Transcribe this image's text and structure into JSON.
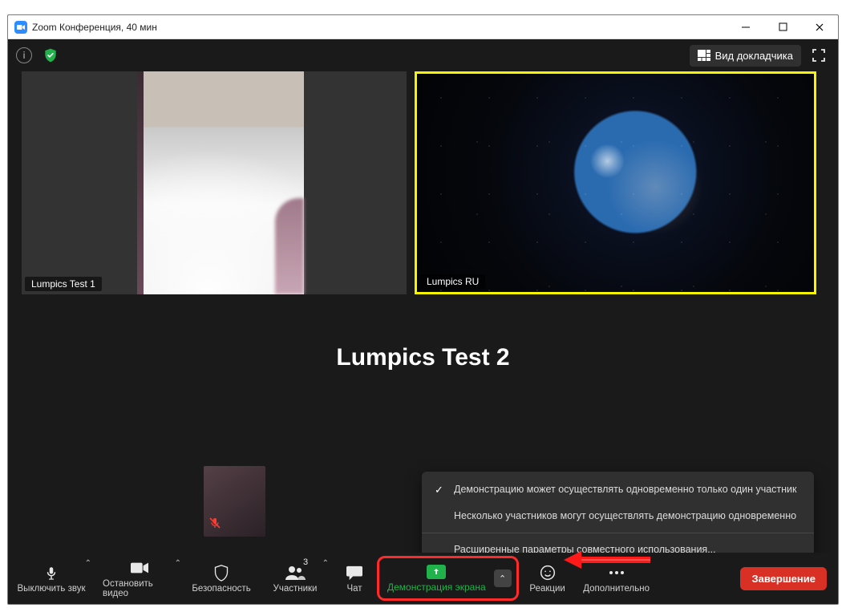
{
  "window": {
    "title": "Zoom Конференция, 40 мин"
  },
  "top": {
    "speaker_view": "Вид докладчика"
  },
  "tiles": {
    "name1": "Lumpics Test 1",
    "name2": "Lumpics RU"
  },
  "main_label": "Lumpics Test 2",
  "share_popup": {
    "opt_single": "Демонстрацию может осуществлять одновременно только один участник",
    "opt_multi": "Несколько участников могут осуществлять демонстрацию одновременно",
    "opt_advanced": "Расширенные параметры совместного использования..."
  },
  "toolbar": {
    "mute": "Выключить звук",
    "video": "Остановить видео",
    "security": "Безопасность",
    "participants": "Участники",
    "participants_count": "3",
    "chat": "Чат",
    "share": "Демонстрация экрана",
    "reactions": "Реакции",
    "more": "Дополнительно",
    "end": "Завершение"
  },
  "colors": {
    "share_green": "#22b24c",
    "end_red": "#d93025",
    "highlight_frame": "#ff2a2a",
    "active_speaker_border": "#f6f400"
  }
}
